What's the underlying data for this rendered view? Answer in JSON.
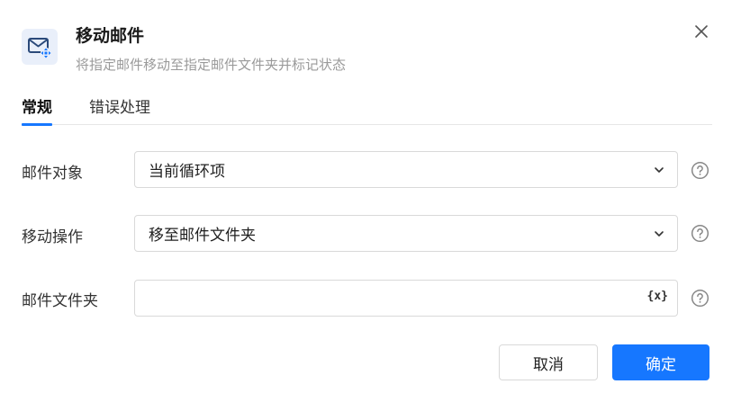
{
  "header": {
    "title": "移动邮件",
    "subtitle": "将指定邮件移动至指定邮件文件夹并标记状态",
    "icon": "mail-move-icon",
    "accent_color": "#1677ff"
  },
  "tabs": [
    {
      "label": "常规",
      "active": true
    },
    {
      "label": "错误处理",
      "active": false
    }
  ],
  "form": {
    "mail_object": {
      "label": "邮件对象",
      "value": "当前循环项"
    },
    "move_action": {
      "label": "移动操作",
      "value": "移至邮件文件夹"
    },
    "mail_folder": {
      "label": "邮件文件夹",
      "value": "",
      "variable_icon": "{x}"
    }
  },
  "footer": {
    "cancel_label": "取消",
    "ok_label": "确定"
  }
}
